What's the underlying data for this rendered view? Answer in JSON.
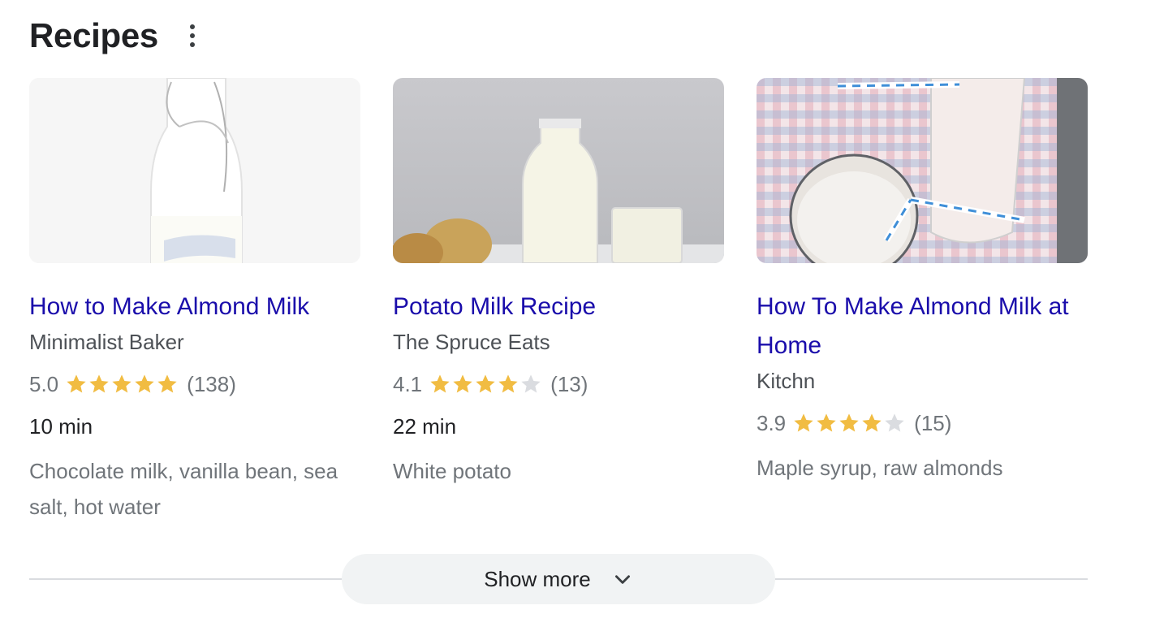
{
  "header": {
    "title": "Recipes",
    "more_icon": "more-vert-icon"
  },
  "colors": {
    "link": "#1a0dab",
    "star_filled": "#f1bc42",
    "star_empty": "#dadce0",
    "pill_bg": "#f1f3f4"
  },
  "cards": [
    {
      "image": "milk-bottle-photo",
      "title": "How to Make Almond Milk",
      "source": "Minimalist Baker",
      "rating": "5.0",
      "stars": 5,
      "reviews": "(138)",
      "time": "10 min",
      "ingredients": "Chocolate milk, vanilla bean, sea salt, hot water"
    },
    {
      "image": "potato-milk-photo",
      "title": "Potato Milk Recipe",
      "source": "The Spruce Eats",
      "rating": "4.1",
      "stars": 4,
      "reviews": "(13)",
      "time": "22 min",
      "ingredients": "White potato"
    },
    {
      "image": "almond-milk-glasses-photo",
      "title": "How To Make Almond Milk at Home",
      "source": "Kitchn",
      "rating": "3.9",
      "stars": 4,
      "reviews": "(15)",
      "time": "",
      "ingredients": "Maple syrup, raw almonds"
    }
  ],
  "footer": {
    "show_more_label": "Show more",
    "chevron_icon": "chevron-down-icon"
  }
}
